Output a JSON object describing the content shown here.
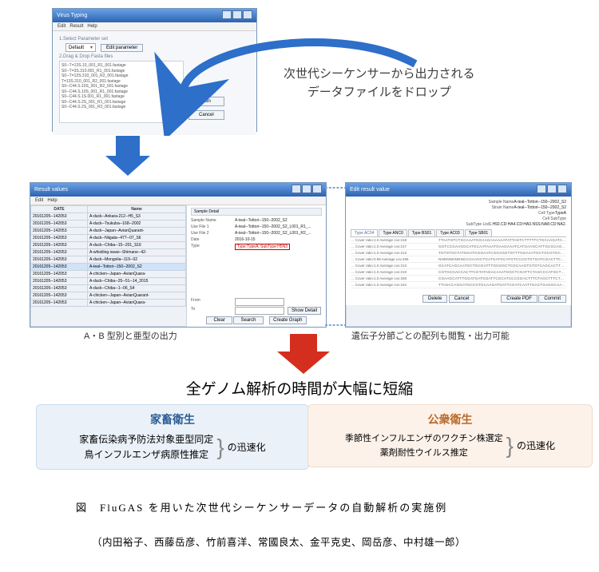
{
  "annot": {
    "drop1": "次世代シーケンサーから出力される",
    "drop2": "データファイルをドロップ",
    "caption1": "A・B 型別と亜型の出力",
    "caption2": "遺伝子分節ごとの配列も閲覧・出力可能",
    "center": "全ゲノム解析の時間が大幅に短縮",
    "fig_title": "図　FluGAS を用いた次世代シーケンサーデータの自動解析の実施例",
    "authors": "（内田裕子、西藤岳彦、竹前喜洋、常國良太、金平克史、岡岳彦、中村雄一郎）"
  },
  "win_typing": {
    "title": "Virus Typing",
    "menu1": "Edit",
    "menu2": "Result",
    "menu3": "Help",
    "sec1": "1.Select Parameter set",
    "dd": "Default",
    "edit_btn": "Edit parameter",
    "sec2": "2.Drag & Drop Fasta files",
    "run": "Run",
    "cancel": "Cancel",
    "files": [
      "S0─T=13S.10_001_R1_001.fastage",
      "S0─T=3S.310.001_R1_001.fastage",
      "S0─T=13S.310_001_R2_001.fastage",
      "T=13S.310_001_R2_001.fastage",
      "S0─C44.S.10S_001_R2_001.fastage",
      "S0─C44.S.10S_001_R1_001.fastage",
      "S0─C44.S.1S.001_R1_001.fastage",
      "S0─C44.S.2S_001_R1_001.fastage",
      "S0─C44.S.2S_001_R2_001.fastage"
    ]
  },
  "win_results": {
    "title": "Result values",
    "menu1": "Edit",
    "menu2": "Help",
    "th_date": "DATE",
    "th_name": "Name",
    "th_detail": "Sample Detail",
    "rows": [
      {
        "d": "20161205─142053",
        "n": "A-duck─Ankara-212─H5_S3"
      },
      {
        "d": "20161205─142053",
        "n": "A-duck─Tsukuba─168─2002"
      },
      {
        "d": "20161205─142053",
        "n": "A-duck─Japan─AvianQuarant-"
      },
      {
        "d": "20161205─142053",
        "n": "A-duck─Niigata─477─07_S6"
      },
      {
        "d": "20161205─142053",
        "n": "A-duck─Chiba─15─201_S16"
      },
      {
        "d": "20161205─142053",
        "n": "A-whistling-swan─Shimane─42-"
      },
      {
        "d": "20161205─142053",
        "n": "A-duck─Mongolia─119─02"
      },
      {
        "d": "20161205─142053",
        "n": "A-teal─Tottori─150─2002_S2"
      },
      {
        "d": "20161205─142053",
        "n": "A-chicken─Japan─AvianQuara-"
      },
      {
        "d": "20161205─142053",
        "n": "A-duck─Chiba─25─51─14_2015"
      },
      {
        "d": "20161205─142053",
        "n": "A-duck─Chiba─1─06_S4"
      },
      {
        "d": "20161205─142053",
        "n": "A-chicken─Japan─AvianQuarant-"
      },
      {
        "d": "20161205─142053",
        "n": "A-chicken─Japan─AvianQuara-"
      }
    ],
    "hl_index": 7,
    "d_sample": "Sample Name",
    "d_sample_v": "A-teal─Tottori─150─2002_S2",
    "d_use1": "Use File 1",
    "d_use1_v": "A-teal─Tottori─150─2002_S2_L001_R1_...",
    "d_use2": "Use File 2",
    "d_use2_v": "A-teal─Tottori─150─2002_S2_L001_R2_...",
    "d_date": "Date",
    "d_date_v": "2016-10-15",
    "d_type": "Type",
    "d_type_v": "Type:TypeA, SubType:H5N3",
    "from": "From",
    "to": "To",
    "clear": "Clear",
    "search": "Search",
    "show_detail": "Show Detail",
    "create_graph": "Create Graph"
  },
  "win_detail": {
    "title": "Edit result value",
    "k_sample": "Sample Name",
    "v_sample": "A-teal─Tottori─150─2002_S2",
    "k_strain": "Strain Name",
    "v_strain": "A-teal─Tottori─150─2002_S2",
    "k_cell": "Cell Type",
    "v_cell": "TypeA",
    "k_sub": "Cell SubType",
    "v_sub": "",
    "k_list": "SubType List",
    "v_list": "1.H92.CD:HA4.CD:HA3.NSS:NA8.CD:NA2.",
    "tabs": [
      "Type AC04",
      "Type ANC0",
      "Type BS01",
      "Type AC03",
      "Type SB01"
    ],
    "rows": [
      {
        "m": "Cover ratio:1.0 Average cov:218",
        "s": "TTAATGTCTGCAAATGGAAGAAAAAATATTAGTCTTTTTCTGCAAGATAGCTCATCTGTCAAAGA"
      },
      {
        "m": "Cover ratio:1.0 Average cov:217",
        "s": "GGTCCGAAGGCATGCAATAAATGAAGAAATCATGAAGCATTGCGCAGTATGGGAGACTCTGTC"
      },
      {
        "m": "Cover ratio:1.0 Average cov:213",
        "s": "TGTGTGCTATGGATGGGAATCGGAGGTGTTTGGACATGCTGCGTGCTGACGTTCGGTTATATTG"
      },
      {
        "m": "Cover ratio:0.99 Average cov:465",
        "s": "NNNNNNNNNGCGAAGCTGATGATGCATGTCCCGTGTGATCGACTTCCATCCGCCTGCAAGGG"
      },
      {
        "m": "Cover ratio:1.0 Average cov:213",
        "s": "GCATCAGCAATGCTGCGATTTGGGGCTCGCAAGTGTGTCAGCACTTGTTGCCTTCGACTTCTTCTGG"
      },
      {
        "m": "Cover ratio:1.0 Average cov:210",
        "s": "CGTGCGACCACTTCGTATAGACAAATGGCTCGATTCTAGCCCATGCTCGGCGAATGCTTCGATT"
      },
      {
        "m": "Cover ratio:1.0 Average cov:348",
        "s": "CGAAGCATTTGGATGATGGATTCGCATCCCGGACTTTCTAGCTTTCTGAAGCAGTGCCAGCGGAAT"
      },
      {
        "m": "Cover ratio:1.0 Average cov:243",
        "s": "TTAGCCAGGATGCCGTGCAAGATGATTCGATCAATTGACTGAGGCAATTGTATCGCAGCTGTTG"
      }
    ],
    "delete": "Delete",
    "cancel": "Cancel",
    "pdf": "Create PDF",
    "commit": "Commit"
  },
  "boxes": {
    "livestock_hdr": "家畜衛生",
    "livestock_l1": "家畜伝染病予防法対象亜型同定",
    "livestock_l2": "鳥インフルエンザ病原性推定",
    "speedup": "の迅速化",
    "public_hdr": "公衆衛生",
    "public_l1": "季節性インフルエンザのワクチン株選定",
    "public_l2": "薬剤耐性ウイルス推定"
  }
}
